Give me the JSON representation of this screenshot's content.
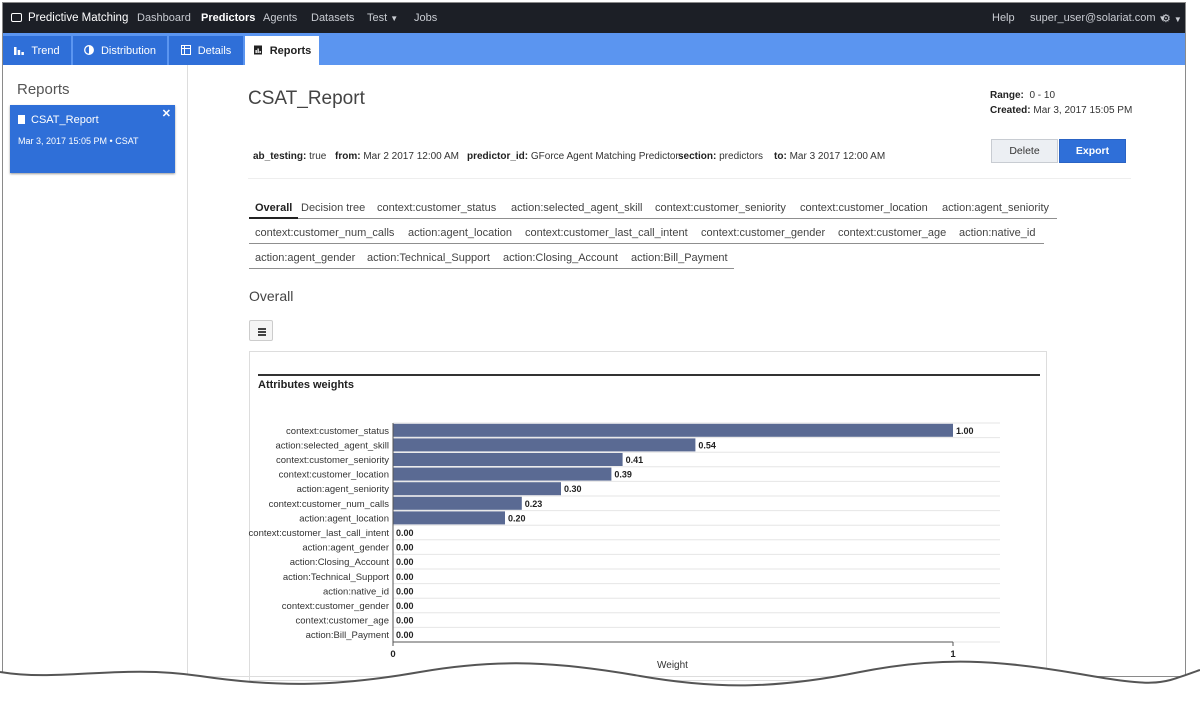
{
  "app": {
    "brand": "Predictive Matching",
    "nav": [
      "Dashboard",
      "Predictors",
      "Agents",
      "Datasets",
      "Test",
      "Jobs"
    ],
    "help": "Help",
    "user": "super_user@solariat.com",
    "active_nav": "Predictors"
  },
  "subtabs": [
    "Trend",
    "Distribution",
    "Details",
    "Reports"
  ],
  "active_subtab": "Reports",
  "sidebar": {
    "title": "Reports",
    "card": {
      "name": "CSAT_Report",
      "meta": "Mar 3, 2017 15:05 PM • CSAT"
    }
  },
  "report": {
    "title": "CSAT_Report",
    "range_label": "Range:",
    "range_value": "0 - 10",
    "created_label": "Created:",
    "created_value": "Mar 3, 2017 15:05 PM",
    "meta": [
      {
        "label": "ab_testing:",
        "value": "true"
      },
      {
        "label": "from:",
        "value": "Mar 2 2017 12:00 AM"
      },
      {
        "label": "predictor_id:",
        "value": "GForce Agent Matching Predictor"
      },
      {
        "label": "section:",
        "value": "predictors"
      },
      {
        "label": "to:",
        "value": "Mar 3 2017 12:00 AM"
      }
    ],
    "delete_label": "Delete",
    "export_label": "Export"
  },
  "filter_tabs": {
    "row1": [
      "Overall",
      "Decision tree",
      "context:customer_status",
      "action:selected_agent_skill",
      "context:customer_seniority",
      "context:customer_location",
      "action:agent_seniority"
    ],
    "row2": [
      "context:customer_num_calls",
      "action:agent_location",
      "context:customer_last_call_intent",
      "context:customer_gender",
      "context:customer_age",
      "action:native_id"
    ],
    "row3": [
      "action:agent_gender",
      "action:Technical_Support",
      "action:Closing_Account",
      "action:Bill_Payment"
    ],
    "active": "Overall"
  },
  "section_title": "Overall",
  "chart_data": {
    "type": "bar",
    "orientation": "horizontal",
    "title": "Attributes weights",
    "xlabel": "Weight",
    "xlim": [
      0,
      1
    ],
    "xticks": [
      "0",
      "1"
    ],
    "grid": true,
    "categories": [
      "context:customer_status",
      "action:selected_agent_skill",
      "context:customer_seniority",
      "context:customer_location",
      "action:agent_seniority",
      "context:customer_num_calls",
      "action:agent_location",
      "context:customer_last_call_intent",
      "action:agent_gender",
      "action:Closing_Account",
      "action:Technical_Support",
      "action:native_id",
      "context:customer_gender",
      "context:customer_age",
      "action:Bill_Payment"
    ],
    "values": [
      1.0,
      0.54,
      0.41,
      0.39,
      0.3,
      0.23,
      0.2,
      0.0,
      0.0,
      0.0,
      0.0,
      0.0,
      0.0,
      0.0,
      0.0
    ],
    "value_labels": [
      "1.00",
      "0.54",
      "0.41",
      "0.39",
      "0.30",
      "0.23",
      "0.20",
      "0.00",
      "0.00",
      "0.00",
      "0.00",
      "0.00",
      "0.00",
      "0.00",
      "0.00"
    ],
    "bar_color": "#5a6a93"
  },
  "colors": {
    "accent": "#2f6fd8",
    "subbar": "#5b95f0",
    "topnav": "#1c1f26"
  }
}
